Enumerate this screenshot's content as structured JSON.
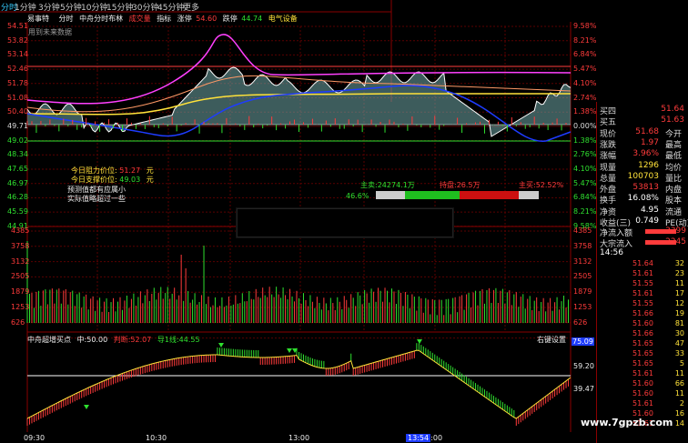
{
  "tabs": [
    "分时",
    "1分钟",
    "3分钟",
    "5分钟",
    "10分钟",
    "15分钟",
    "30分钟",
    "45分钟",
    "更多"
  ],
  "header_items": [
    "易事特",
    "分时",
    "中舟分时布林",
    "成交量",
    "指标",
    "涨停",
    "54.60",
    "跌停",
    "44.74",
    "电气设备"
  ],
  "no_future_data": "用到未来数据",
  "left_price_axis": [
    "54.51",
    "53.82",
    "53.14",
    "52.46",
    "51.78",
    "51.08",
    "50.40",
    "49.71",
    "49.02",
    "48.34",
    "47.65",
    "46.97",
    "46.28",
    "45.59",
    "44.91"
  ],
  "right_pct_axis": [
    "9.58%",
    "8.21%",
    "6.84%",
    "5.47%",
    "4.10%",
    "2.74%",
    "1.38%",
    "0.00%",
    "1.38%",
    "2.76%",
    "4.10%",
    "5.47%",
    "6.84%",
    "8.21%",
    "9.58%"
  ],
  "volume_left_axis": [
    "4385",
    "3758",
    "3132",
    "2505",
    "1879",
    "1253",
    "626"
  ],
  "volume_right_axis": [
    "4385",
    "3758",
    "3132",
    "2505",
    "1879",
    "1253",
    "626"
  ],
  "annotations": {
    "resistance_label": "今日阻力价位:",
    "resistance_value": "51.27",
    "resistance_unit": "元",
    "support_label": "今日支撑价位:",
    "support_value": "49.03",
    "support_unit": "元",
    "note1": "预测值都有应属小",
    "note2": "实际值略超过一些"
  },
  "flow_bar": {
    "main_label": "主卖:",
    "main_value": "24274.1万",
    "left_pct": "46.6%",
    "mid_label": "持盘:",
    "mid_value": "26.5万",
    "right_label": "主买:",
    "right_value": "52.52%"
  },
  "indicator": {
    "name": "中舟超增买点",
    "middle_label": "中:",
    "middle_value": "50.00",
    "up_label": "判断:",
    "up_value": "52.07",
    "down_label": "导1线:",
    "down_value": "44.55",
    "axis": [
      "75.09",
      "59.20",
      "39.47"
    ],
    "settings_label": "右键设置"
  },
  "time_axis": [
    "09:30",
    "10:30",
    "13:00",
    "14:00"
  ],
  "cursor_time": "13:54",
  "quote": {
    "rows": [
      {
        "label": "买四",
        "value": "51.64",
        "extra": "",
        "extra_label": ""
      },
      {
        "label": "买五",
        "value": "51.63",
        "extra": "",
        "extra_label": ""
      },
      {
        "label": "现价",
        "value": "51.68",
        "extra": "",
        "extra_label": "今开"
      },
      {
        "label": "涨跌",
        "value": "1.97",
        "extra": "",
        "extra_label": "最高"
      },
      {
        "label": "涨幅",
        "value": "3.96%",
        "extra": "",
        "extra_label": "最低"
      },
      {
        "label": "现量",
        "value": "1296",
        "extra": "",
        "extra_label": "均价"
      },
      {
        "label": "总量",
        "value": "100703",
        "extra": "",
        "extra_label": "量比"
      },
      {
        "label": "外盘",
        "value": "53813",
        "extra": "",
        "extra_label": "内盘"
      },
      {
        "label": "换手",
        "value": "16.08%",
        "extra": "",
        "extra_label": "股本"
      },
      {
        "label": "净资",
        "value": "4.95",
        "extra": "",
        "extra_label": "流通"
      },
      {
        "label": "收益(三)",
        "value": "0.749",
        "extra": "",
        "extra_label": "PE(动)"
      }
    ],
    "net_inflow_label": "净流入额",
    "net_inflow_value": "3399",
    "big_inflow_label": "大宗流入",
    "big_inflow_value": "2245",
    "time": "14:56",
    "trades": [
      {
        "price": "51.64",
        "vol": "32"
      },
      {
        "price": "51.61",
        "vol": "23"
      },
      {
        "price": "51.55",
        "vol": "11"
      },
      {
        "price": "51.61",
        "vol": "17"
      },
      {
        "price": "51.55",
        "vol": "12"
      },
      {
        "price": "51.66",
        "vol": "19"
      },
      {
        "price": "51.60",
        "vol": "81"
      },
      {
        "price": "51.66",
        "vol": "30"
      },
      {
        "price": "51.65",
        "vol": "47"
      },
      {
        "price": "51.65",
        "vol": "33"
      },
      {
        "price": "51.65",
        "vol": "5"
      },
      {
        "price": "51.61",
        "vol": "11"
      },
      {
        "price": "51.60",
        "vol": "66"
      },
      {
        "price": "51.60",
        "vol": "11"
      },
      {
        "price": "51.61",
        "vol": "2"
      },
      {
        "price": "51.60",
        "vol": "16"
      },
      {
        "price": "51.61",
        "vol": "14"
      }
    ]
  },
  "watermark": "www.7gpzb.com",
  "colors": {
    "up": "#ff3b3b",
    "down": "#2fe02f",
    "price_line": "#ffffff",
    "avg_line": "#ffe23a",
    "boll_upper": "#ff40ff",
    "boll_lower": "#1e3cff",
    "area_fill": "#7ab3b3"
  }
}
